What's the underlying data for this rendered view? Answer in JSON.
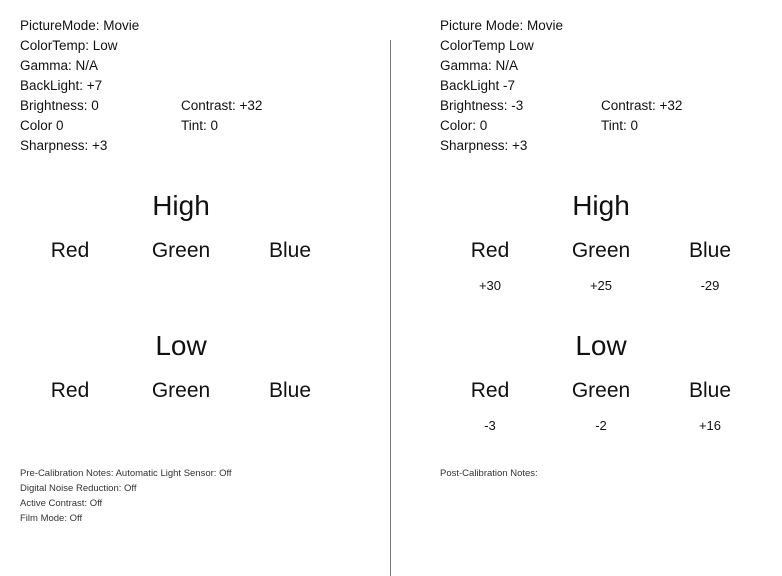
{
  "pre": {
    "settings": {
      "picture_mode": "PictureMode: Movie",
      "color_temp": "ColorTemp: Low",
      "gamma": "Gamma: N/A",
      "backlight": "BackLight: +7",
      "brightness": "Brightness: 0",
      "contrast": "Contrast: +32",
      "color": "Color  0",
      "tint": "Tint: 0",
      "sharpness": "Sharpness: +3"
    },
    "high": {
      "title": "High",
      "red": "Red",
      "green": "Green",
      "blue": "Blue"
    },
    "low": {
      "title": "Low",
      "red": "Red",
      "green": "Green",
      "blue": "Blue"
    },
    "notes": [
      "Pre-Calibration Notes: Automatic Light Sensor: Off",
      "Digital Noise Reduction: Off",
      "Active Contrast: Off",
      "Film Mode: Off"
    ]
  },
  "post": {
    "settings": {
      "picture_mode": "Picture Mode: Movie",
      "color_temp": "ColorTemp  Low",
      "gamma": "Gamma: N/A",
      "backlight": "BackLight  -7",
      "brightness": "Brightness: -3",
      "contrast": "Contrast: +32",
      "color": "Color: 0",
      "tint": "Tint: 0",
      "sharpness": "Sharpness: +3"
    },
    "high": {
      "title": "High",
      "red": "Red",
      "green": "Green",
      "blue": "Blue",
      "red_value": "+30",
      "green_value": "+25",
      "blue_value": "-29"
    },
    "low": {
      "title": "Low",
      "red": "Red",
      "green": "Green",
      "blue": "Blue",
      "red_value": "-3",
      "green_value": "-2",
      "blue_value": "+16"
    },
    "notes": [
      "Post-Calibration Notes:"
    ]
  }
}
